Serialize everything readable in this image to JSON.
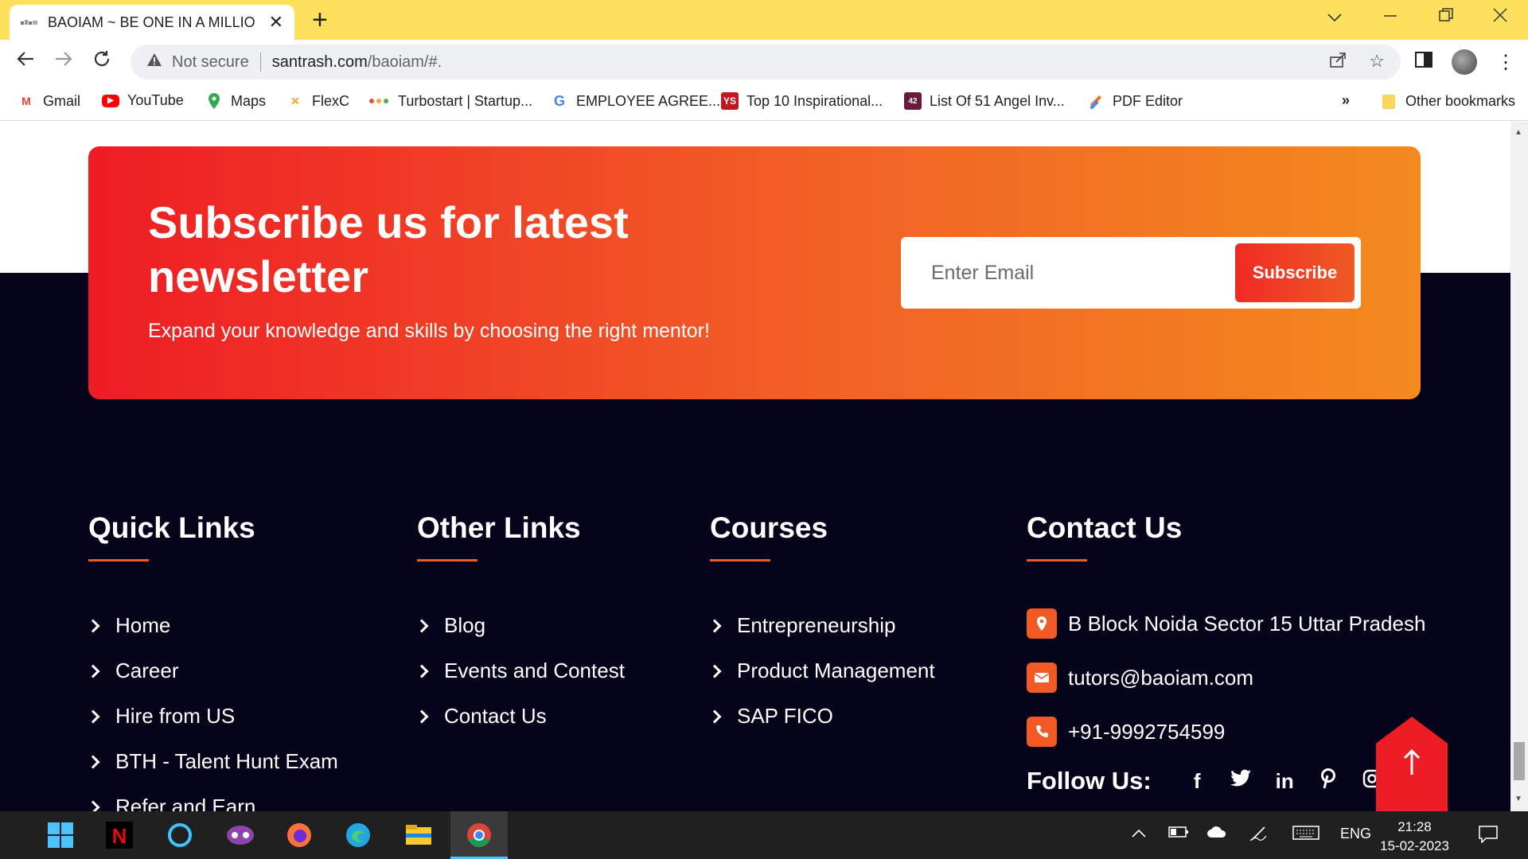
{
  "browser": {
    "tab_title": "BAOIAM ~ BE ONE IN A MILLION",
    "omnibox": {
      "security": "Not secure",
      "host": "santrash.com",
      "path": "/baoiam/#."
    },
    "bookmarks": [
      {
        "label": "Gmail",
        "icon": "gmail-icon",
        "color": "#ea4335"
      },
      {
        "label": "YouTube",
        "icon": "youtube-icon",
        "color": "#ff0000"
      },
      {
        "label": "Maps",
        "icon": "maps-icon",
        "color": "#34a853"
      },
      {
        "label": "FlexC",
        "icon": "flexc-icon",
        "color": "#f5a623"
      },
      {
        "label": "Turbostart | Startup...",
        "icon": "turbostart-icon",
        "color": "#e94e3c"
      },
      {
        "label": "EMPLOYEE AGREE...",
        "icon": "google-icon",
        "color": "#4285f4"
      },
      {
        "label": "Top 10 Inspirational...",
        "icon": "yourstory-icon",
        "color": "#c4161c"
      },
      {
        "label": "List Of 51 Angel Inv...",
        "icon": "inc42-icon",
        "color": "#6a1b3d"
      },
      {
        "label": "PDF Editor",
        "icon": "pdf-editor-icon",
        "color": "#f37021"
      }
    ],
    "overflow": "»",
    "other_bookmarks": "Other bookmarks"
  },
  "newsletter": {
    "title": "Subscribe us for latest newsletter",
    "description": "Expand your knowledge and skills by choosing the right mentor!",
    "email_placeholder": "Enter Email",
    "button": "Subscribe"
  },
  "footer": {
    "quick_links": {
      "title": "Quick Links",
      "items": [
        "Home",
        "Career",
        "Hire from US",
        "BTH - Talent Hunt Exam",
        "Refer and Earn"
      ]
    },
    "other_links": {
      "title": "Other Links",
      "items": [
        "Blog",
        "Events and Contest",
        "Contact Us"
      ]
    },
    "courses": {
      "title": "Courses",
      "items": [
        "Entrepreneurship",
        "Product Management",
        "SAP FICO"
      ]
    },
    "contact": {
      "title": "Contact Us",
      "address": "B Block Noida Sector 15 Uttar Pradesh",
      "email": "tutors@baoiam.com",
      "phone": "+91-9992754599",
      "follow_label": "Follow Us:",
      "socials": [
        "facebook-icon",
        "twitter-icon",
        "linkedin-icon",
        "pinterest-icon",
        "instagram-icon"
      ]
    }
  },
  "taskbar": {
    "apps": [
      "windows-start-icon",
      "netflix-icon",
      "cortana-icon",
      "game-icon",
      "firefox-icon",
      "edge-icon",
      "file-explorer-icon",
      "chrome-icon"
    ],
    "language": "ENG",
    "time": "21:28",
    "date": "15-02-2023"
  },
  "colors": {
    "tabstrip": "#fde15e",
    "accent": "#f15a24",
    "footer_bg": "#06041a"
  }
}
